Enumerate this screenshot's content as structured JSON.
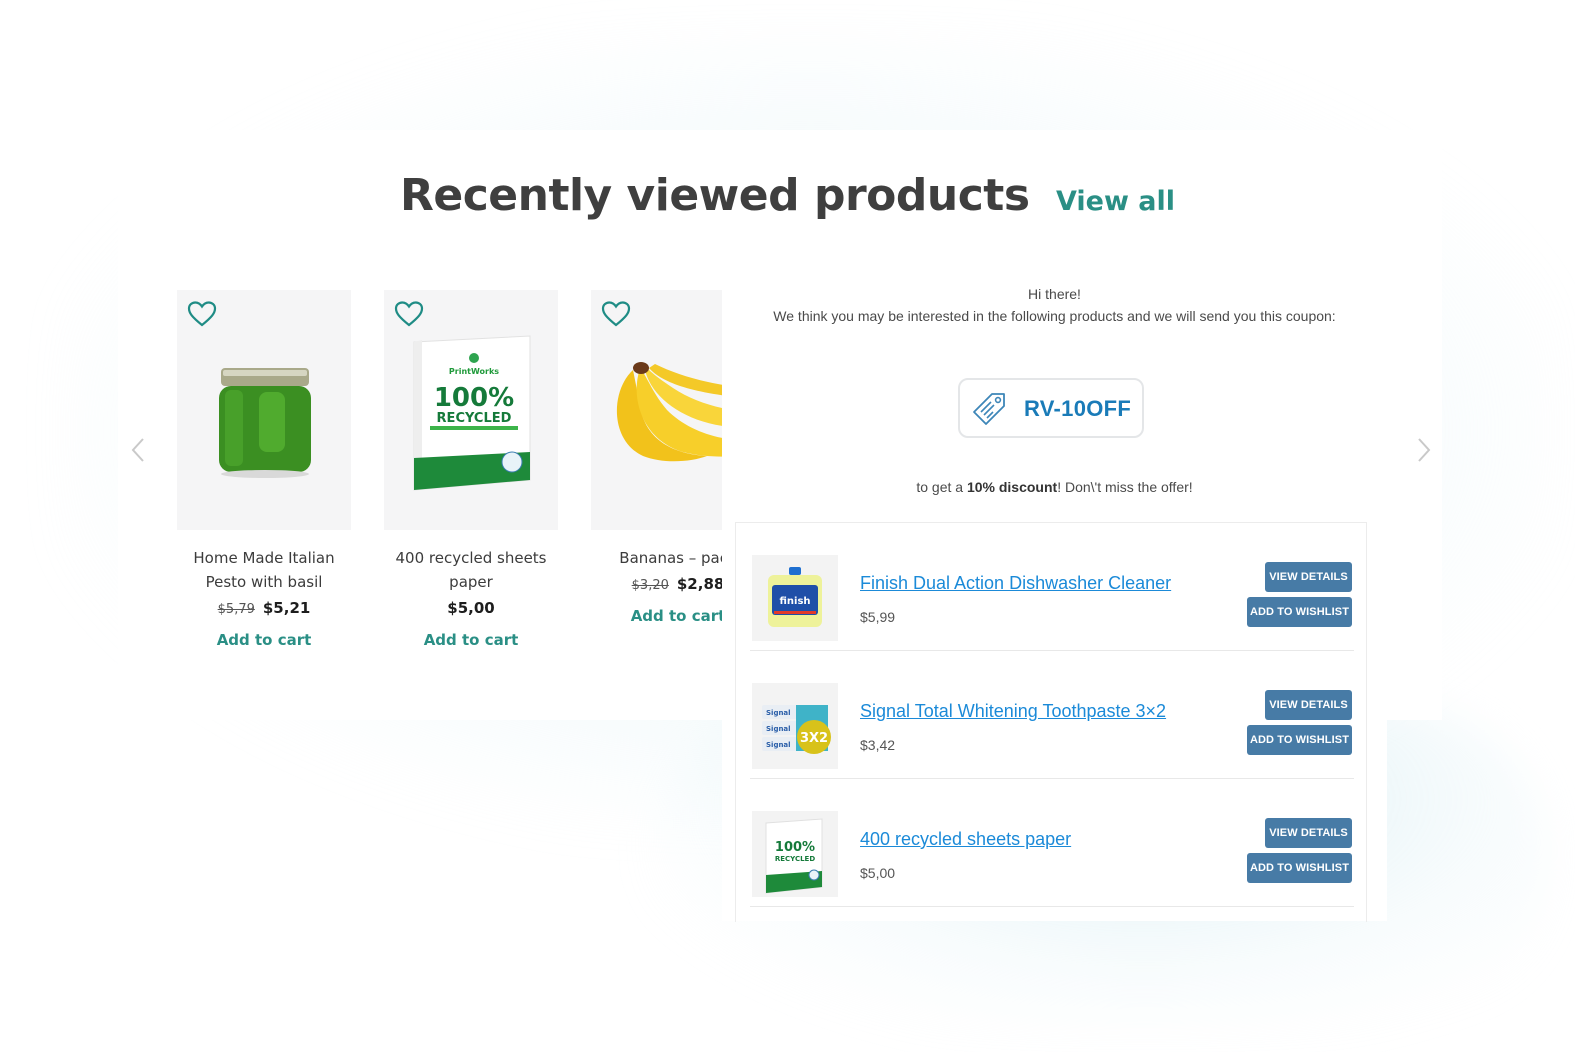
{
  "header": {
    "title": "Recently viewed products",
    "view_all": "View all"
  },
  "carousel": {
    "prev_icon": "chevron-left-icon",
    "next_icon": "chevron-right-icon",
    "products": [
      {
        "name": "Home Made Italian Pesto with basil",
        "price_old": "$5,79",
        "price_new": "$5,21",
        "cta": "Add to cart",
        "image": "pesto-jar"
      },
      {
        "name": "400 recycled sheets paper",
        "price_old": "",
        "price_new": "$5,00",
        "cta": "Add to cart",
        "image": "recycled-paper-ream"
      },
      {
        "name": "Bananas – pack",
        "price_old": "$3,20",
        "price_new": "$2,88",
        "cta": "Add to cart",
        "image": "bananas"
      }
    ]
  },
  "email": {
    "greeting": "Hi there!",
    "intro": "We think you may be interested in the following products and we will send you this coupon:",
    "coupon_code": "RV-10OFF",
    "coupon_icon": "tag-icon",
    "discount_prefix": "to get a ",
    "discount_bold": "10% discount",
    "discount_suffix": "! Don\\'t miss the offer!",
    "items": [
      {
        "title": "Finish Dual Action Dishwasher Cleaner",
        "price": "$5,99",
        "view_label": "VIEW DETAILS",
        "wishlist_label": "ADD TO WISHLIST"
      },
      {
        "title": "Signal Total Whitening Toothpaste 3×2",
        "price": "$3,42",
        "view_label": "VIEW DETAILS",
        "wishlist_label": "ADD TO WISHLIST"
      },
      {
        "title": "400 recycled sheets paper",
        "price": "$5,00",
        "view_label": "VIEW DETAILS",
        "wishlist_label": "ADD TO WISHLIST"
      }
    ]
  },
  "colors": {
    "accent_teal": "#2a8f85",
    "link_blue": "#1b8ad8",
    "button_blue": "#477ba6",
    "coupon_blue": "#1a7bb8"
  }
}
